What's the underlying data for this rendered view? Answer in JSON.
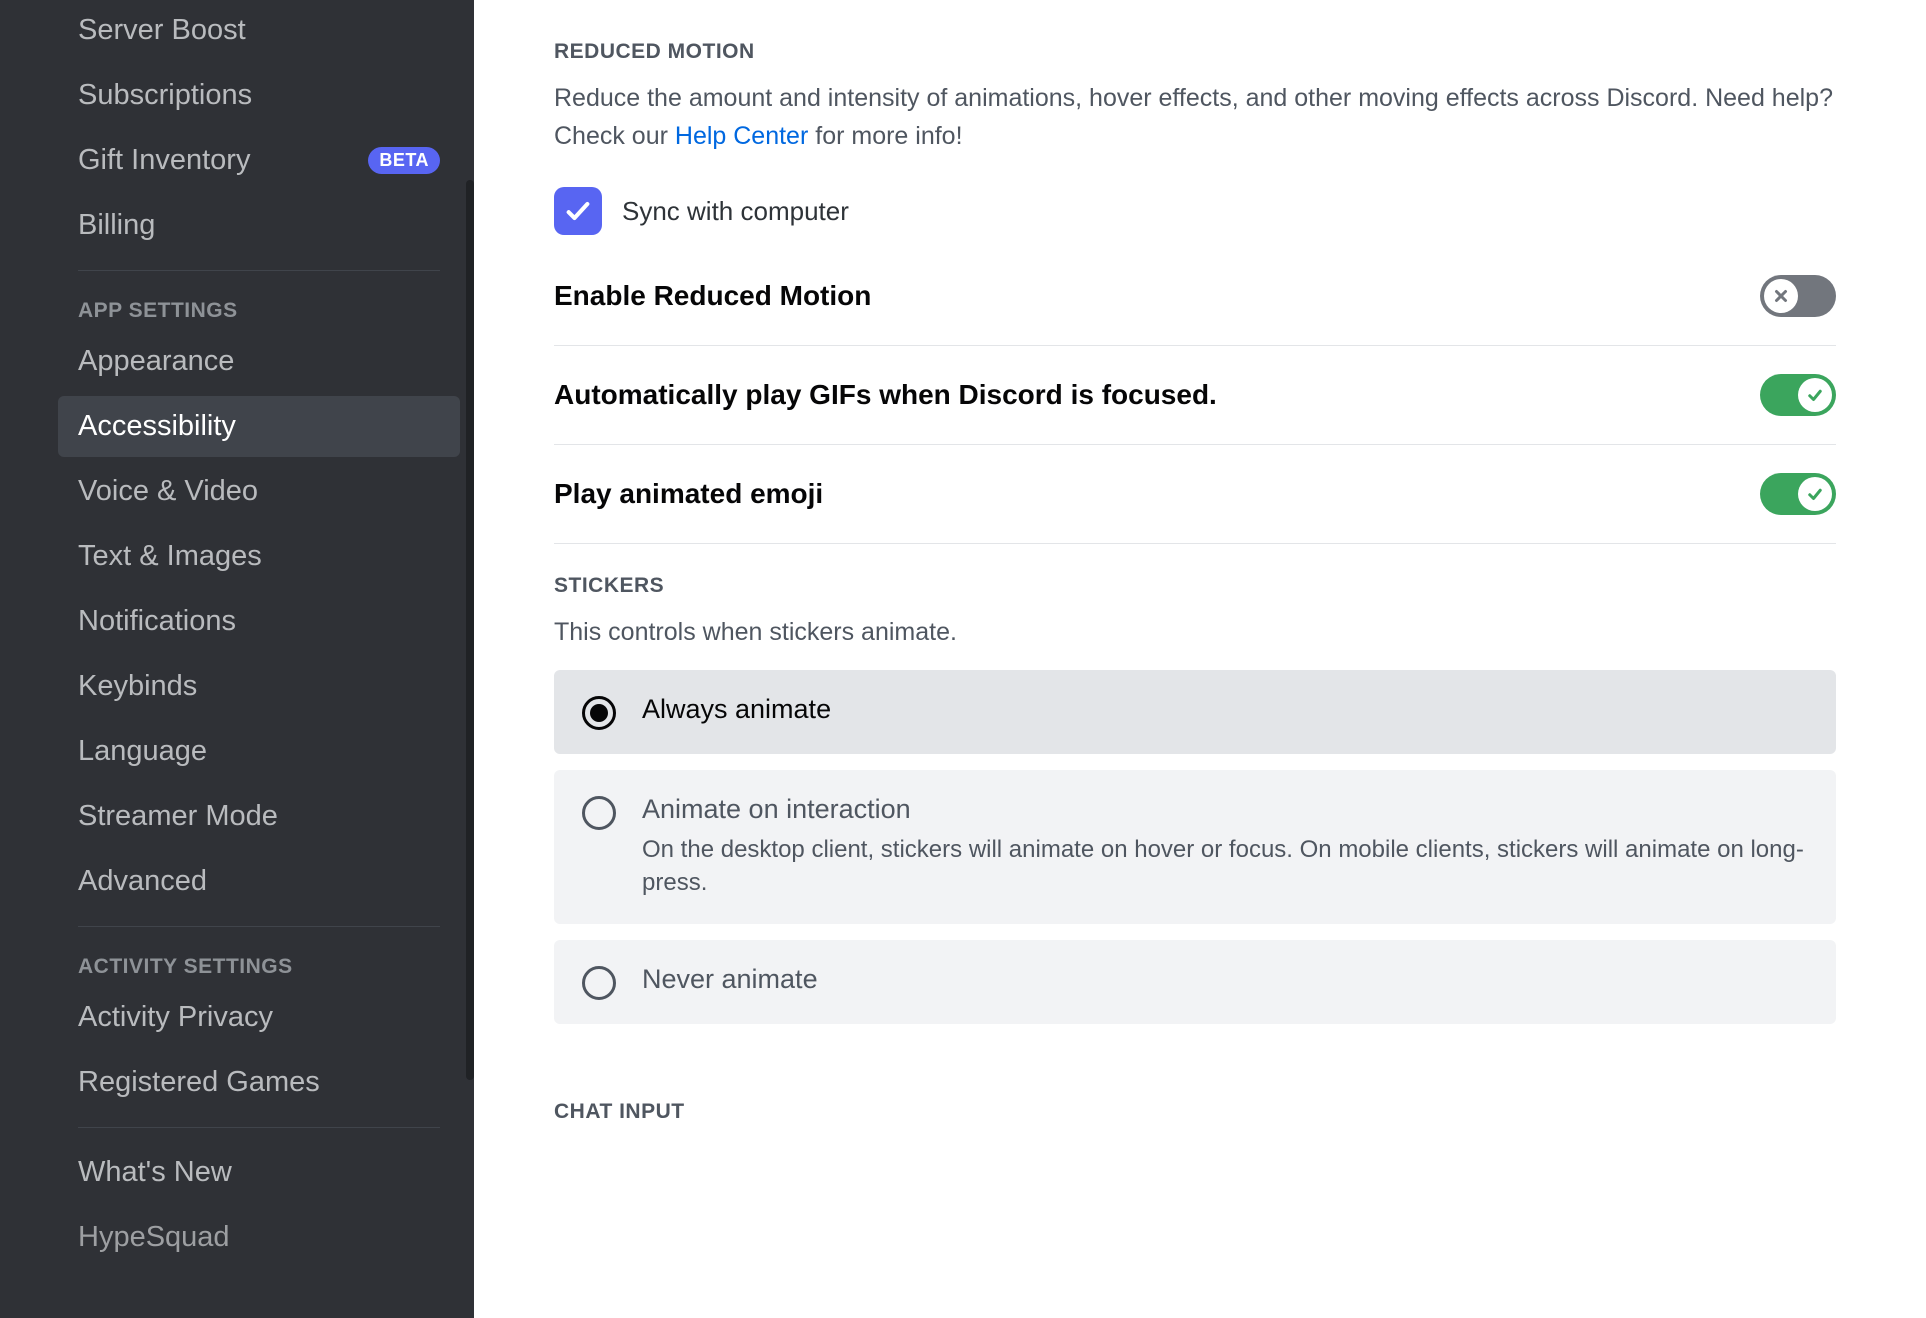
{
  "sidebar": {
    "items_top": [
      {
        "label": "Server Boost"
      },
      {
        "label": "Subscriptions"
      },
      {
        "label": "Gift Inventory",
        "badge": "BETA"
      },
      {
        "label": "Billing"
      }
    ],
    "header_app": "APP SETTINGS",
    "items_app": [
      {
        "label": "Appearance"
      },
      {
        "label": "Accessibility",
        "active": true
      },
      {
        "label": "Voice & Video"
      },
      {
        "label": "Text & Images"
      },
      {
        "label": "Notifications"
      },
      {
        "label": "Keybinds"
      },
      {
        "label": "Language"
      },
      {
        "label": "Streamer Mode"
      },
      {
        "label": "Advanced"
      }
    ],
    "header_activity": "ACTIVITY SETTINGS",
    "items_activity": [
      {
        "label": "Activity Privacy"
      },
      {
        "label": "Registered Games"
      }
    ],
    "items_bottom": [
      {
        "label": "What's New"
      },
      {
        "label": "HypeSquad"
      }
    ]
  },
  "main": {
    "reduced_motion": {
      "title": "REDUCED MOTION",
      "desc_1": "Reduce the amount and intensity of animations, hover effects, and other moving effects across Discord. Need help? Check our ",
      "link": "Help Center",
      "desc_2": " for more info!",
      "sync_checkbox": {
        "label": "Sync with computer",
        "checked": true
      }
    },
    "toggles": [
      {
        "label": "Enable Reduced Motion",
        "on": false
      },
      {
        "label": "Automatically play GIFs when Discord is focused.",
        "on": true
      },
      {
        "label": "Play animated emoji",
        "on": true
      }
    ],
    "stickers": {
      "title": "STICKERS",
      "desc": "This controls when stickers animate.",
      "options": [
        {
          "label": "Always animate",
          "selected": true
        },
        {
          "label": "Animate on interaction",
          "sublabel": "On the desktop client, stickers will animate on hover or focus. On mobile clients, stickers will animate on long-press."
        },
        {
          "label": "Never animate"
        }
      ]
    },
    "chat_input": {
      "title": "CHAT INPUT"
    }
  }
}
